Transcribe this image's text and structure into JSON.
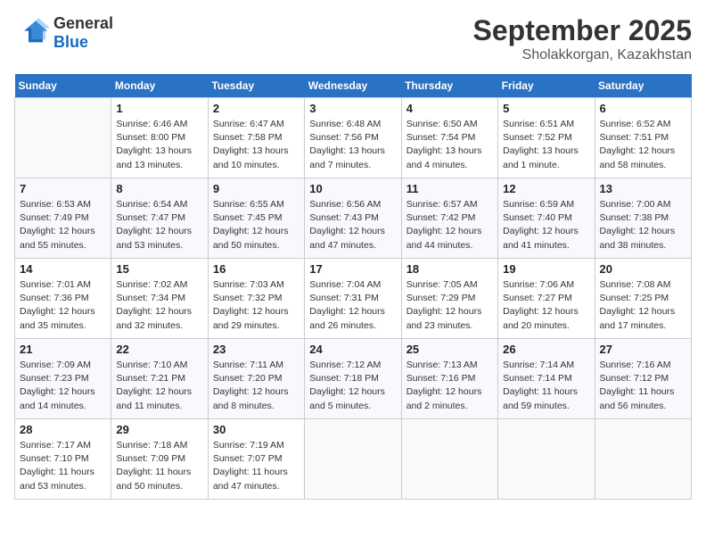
{
  "header": {
    "logo_general": "General",
    "logo_blue": "Blue",
    "month_year": "September 2025",
    "location": "Sholakkorgan, Kazakhstan"
  },
  "days_of_week": [
    "Sunday",
    "Monday",
    "Tuesday",
    "Wednesday",
    "Thursday",
    "Friday",
    "Saturday"
  ],
  "weeks": [
    [
      {
        "day": "",
        "empty": true
      },
      {
        "day": "1",
        "sunrise": "Sunrise: 6:46 AM",
        "sunset": "Sunset: 8:00 PM",
        "daylight": "Daylight: 13 hours and 13 minutes."
      },
      {
        "day": "2",
        "sunrise": "Sunrise: 6:47 AM",
        "sunset": "Sunset: 7:58 PM",
        "daylight": "Daylight: 13 hours and 10 minutes."
      },
      {
        "day": "3",
        "sunrise": "Sunrise: 6:48 AM",
        "sunset": "Sunset: 7:56 PM",
        "daylight": "Daylight: 13 hours and 7 minutes."
      },
      {
        "day": "4",
        "sunrise": "Sunrise: 6:50 AM",
        "sunset": "Sunset: 7:54 PM",
        "daylight": "Daylight: 13 hours and 4 minutes."
      },
      {
        "day": "5",
        "sunrise": "Sunrise: 6:51 AM",
        "sunset": "Sunset: 7:52 PM",
        "daylight": "Daylight: 13 hours and 1 minute."
      },
      {
        "day": "6",
        "sunrise": "Sunrise: 6:52 AM",
        "sunset": "Sunset: 7:51 PM",
        "daylight": "Daylight: 12 hours and 58 minutes."
      }
    ],
    [
      {
        "day": "7",
        "sunrise": "Sunrise: 6:53 AM",
        "sunset": "Sunset: 7:49 PM",
        "daylight": "Daylight: 12 hours and 55 minutes."
      },
      {
        "day": "8",
        "sunrise": "Sunrise: 6:54 AM",
        "sunset": "Sunset: 7:47 PM",
        "daylight": "Daylight: 12 hours and 53 minutes."
      },
      {
        "day": "9",
        "sunrise": "Sunrise: 6:55 AM",
        "sunset": "Sunset: 7:45 PM",
        "daylight": "Daylight: 12 hours and 50 minutes."
      },
      {
        "day": "10",
        "sunrise": "Sunrise: 6:56 AM",
        "sunset": "Sunset: 7:43 PM",
        "daylight": "Daylight: 12 hours and 47 minutes."
      },
      {
        "day": "11",
        "sunrise": "Sunrise: 6:57 AM",
        "sunset": "Sunset: 7:42 PM",
        "daylight": "Daylight: 12 hours and 44 minutes."
      },
      {
        "day": "12",
        "sunrise": "Sunrise: 6:59 AM",
        "sunset": "Sunset: 7:40 PM",
        "daylight": "Daylight: 12 hours and 41 minutes."
      },
      {
        "day": "13",
        "sunrise": "Sunrise: 7:00 AM",
        "sunset": "Sunset: 7:38 PM",
        "daylight": "Daylight: 12 hours and 38 minutes."
      }
    ],
    [
      {
        "day": "14",
        "sunrise": "Sunrise: 7:01 AM",
        "sunset": "Sunset: 7:36 PM",
        "daylight": "Daylight: 12 hours and 35 minutes."
      },
      {
        "day": "15",
        "sunrise": "Sunrise: 7:02 AM",
        "sunset": "Sunset: 7:34 PM",
        "daylight": "Daylight: 12 hours and 32 minutes."
      },
      {
        "day": "16",
        "sunrise": "Sunrise: 7:03 AM",
        "sunset": "Sunset: 7:32 PM",
        "daylight": "Daylight: 12 hours and 29 minutes."
      },
      {
        "day": "17",
        "sunrise": "Sunrise: 7:04 AM",
        "sunset": "Sunset: 7:31 PM",
        "daylight": "Daylight: 12 hours and 26 minutes."
      },
      {
        "day": "18",
        "sunrise": "Sunrise: 7:05 AM",
        "sunset": "Sunset: 7:29 PM",
        "daylight": "Daylight: 12 hours and 23 minutes."
      },
      {
        "day": "19",
        "sunrise": "Sunrise: 7:06 AM",
        "sunset": "Sunset: 7:27 PM",
        "daylight": "Daylight: 12 hours and 20 minutes."
      },
      {
        "day": "20",
        "sunrise": "Sunrise: 7:08 AM",
        "sunset": "Sunset: 7:25 PM",
        "daylight": "Daylight: 12 hours and 17 minutes."
      }
    ],
    [
      {
        "day": "21",
        "sunrise": "Sunrise: 7:09 AM",
        "sunset": "Sunset: 7:23 PM",
        "daylight": "Daylight: 12 hours and 14 minutes."
      },
      {
        "day": "22",
        "sunrise": "Sunrise: 7:10 AM",
        "sunset": "Sunset: 7:21 PM",
        "daylight": "Daylight: 12 hours and 11 minutes."
      },
      {
        "day": "23",
        "sunrise": "Sunrise: 7:11 AM",
        "sunset": "Sunset: 7:20 PM",
        "daylight": "Daylight: 12 hours and 8 minutes."
      },
      {
        "day": "24",
        "sunrise": "Sunrise: 7:12 AM",
        "sunset": "Sunset: 7:18 PM",
        "daylight": "Daylight: 12 hours and 5 minutes."
      },
      {
        "day": "25",
        "sunrise": "Sunrise: 7:13 AM",
        "sunset": "Sunset: 7:16 PM",
        "daylight": "Daylight: 12 hours and 2 minutes."
      },
      {
        "day": "26",
        "sunrise": "Sunrise: 7:14 AM",
        "sunset": "Sunset: 7:14 PM",
        "daylight": "Daylight: 11 hours and 59 minutes."
      },
      {
        "day": "27",
        "sunrise": "Sunrise: 7:16 AM",
        "sunset": "Sunset: 7:12 PM",
        "daylight": "Daylight: 11 hours and 56 minutes."
      }
    ],
    [
      {
        "day": "28",
        "sunrise": "Sunrise: 7:17 AM",
        "sunset": "Sunset: 7:10 PM",
        "daylight": "Daylight: 11 hours and 53 minutes."
      },
      {
        "day": "29",
        "sunrise": "Sunrise: 7:18 AM",
        "sunset": "Sunset: 7:09 PM",
        "daylight": "Daylight: 11 hours and 50 minutes."
      },
      {
        "day": "30",
        "sunrise": "Sunrise: 7:19 AM",
        "sunset": "Sunset: 7:07 PM",
        "daylight": "Daylight: 11 hours and 47 minutes."
      },
      {
        "day": "",
        "empty": true
      },
      {
        "day": "",
        "empty": true
      },
      {
        "day": "",
        "empty": true
      },
      {
        "day": "",
        "empty": true
      }
    ]
  ]
}
